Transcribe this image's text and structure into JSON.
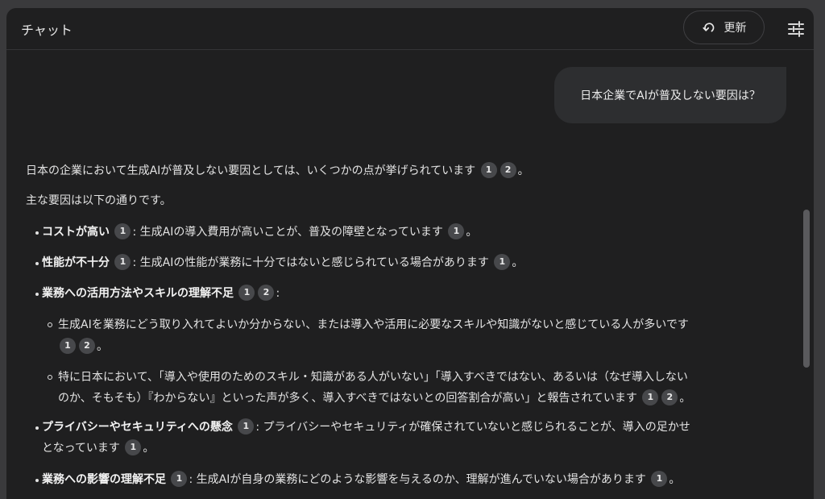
{
  "header": {
    "title": "チャット",
    "refresh_label": "更新",
    "refresh_icon": "refresh-icon",
    "settings_icon": "tune-icon"
  },
  "user_message": "日本企業でAIが普及しない要因は？",
  "answer": {
    "intro": "日本の企業において生成AIが普及しない要因としては、いくつかの点が挙げられています",
    "intro_end": "。",
    "lead": "主な要因は以下の通りです。",
    "items": [
      {
        "title": "コストが高い",
        "text": ": 生成AIの導入費用が高いことが、普及の障壁となっています",
        "end": "。"
      },
      {
        "title": "性能が不十分",
        "text": ": 生成AIの性能が業務に十分ではないと感じられている場合があります",
        "end": "。"
      },
      {
        "title": "業務への活用方法やスキルの理解不足",
        "text": ":",
        "subitems": [
          {
            "line1": "生成AIを業務にどう取り入れてよいか分からない、または導入や活用に必要なスキルや知識がないと感じている人が多いです",
            "end": "。"
          },
          {
            "line1": "特に日本において、「導入や使用のためのスキル・知識がある人がいない」「導入すべきではない、あるいは（なぜ導入しない",
            "line2": "のか、そもそも）『わからない』といった声が多く、導入すべきではないとの回答割合が高い」と報告されています",
            "end": "。"
          }
        ]
      },
      {
        "title": "プライバシーやセキュリティへの懸念",
        "text": ": プライバシーやセキュリティが確保されていないと感じられることが、導入の足かせ",
        "line2": "となっています",
        "end": "。"
      },
      {
        "title": "業務への影響の理解不足",
        "text": ": 生成AIが自身の業務にどのような影響を与えるのか、理解が進んでいない場合があります",
        "end": "。"
      }
    ]
  },
  "citations": {
    "c1": "1",
    "c2": "2"
  },
  "colors": {
    "background": "#1f1f20",
    "bubble": "#2d2e30",
    "citation_chip": "#47484b",
    "text": "#e3e3e3"
  }
}
